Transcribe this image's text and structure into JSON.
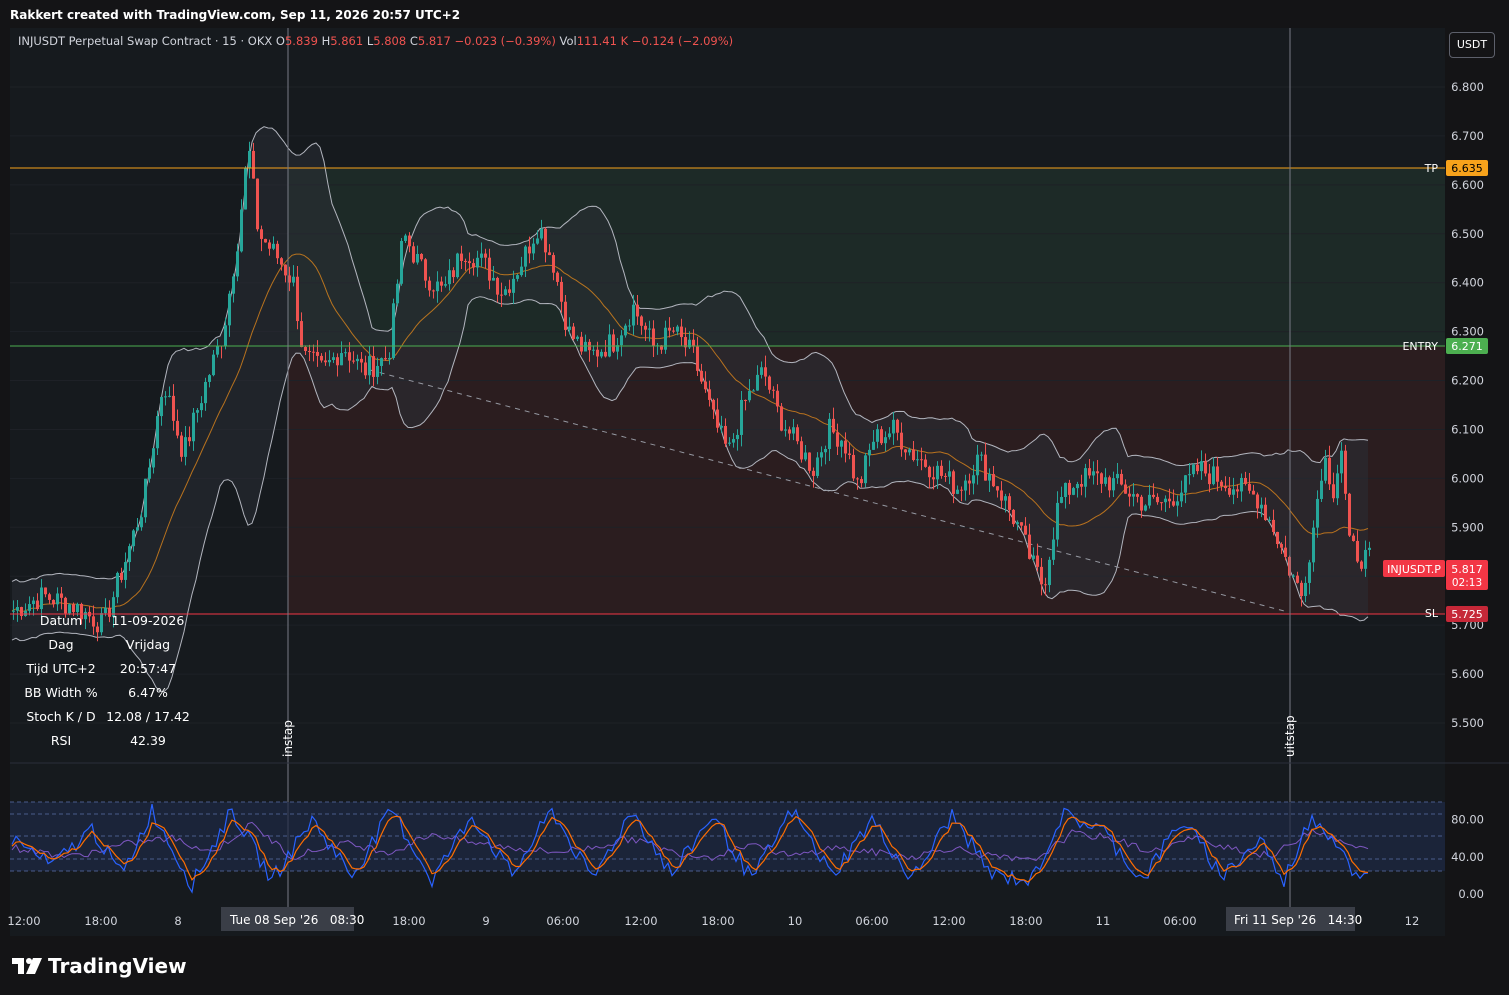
{
  "header": {
    "created_text": "Rakkert created with TradingView.com, Sep 11, 2026 20:57 UTC+2"
  },
  "legend": {
    "symbol": "INJUSDT Perpetual Swap Contract · 15 · OKX",
    "o_label": "O",
    "o_value": "5.839",
    "h_label": "H",
    "h_value": "5.861",
    "l_label": "L",
    "l_value": "5.808",
    "c_label": "C",
    "c_value": "5.817",
    "change": "−0.023 (−0.39%)",
    "vol_label": "Vol",
    "vol_value": "111.41 K",
    "vol_change": "−0.124 (−2.09%)"
  },
  "unit_label": "USDT",
  "price_axis": {
    "ticks": [
      "6.800",
      "6.700",
      "6.600",
      "6.500",
      "6.400",
      "6.300",
      "6.200",
      "6.100",
      "6.000",
      "5.900",
      "5.800",
      "5.700",
      "5.600",
      "5.500"
    ]
  },
  "osc_axis": {
    "ticks": [
      "80.00",
      "40.00",
      "0.00"
    ]
  },
  "time_axis": {
    "labels": [
      "12:00",
      "18:00",
      "8",
      "18:00",
      "9",
      "06:00",
      "12:00",
      "18:00",
      "10",
      "06:00",
      "12:00",
      "18:00",
      "11",
      "06:00",
      "12"
    ],
    "highlight_left": "Tue 08 Sep '26   08:30",
    "highlight_right": "Fri 11 Sep '26   14:30"
  },
  "levels": {
    "tp": {
      "label": "TP",
      "value": "6.635",
      "color": "#f7a21b"
    },
    "entry": {
      "label": "ENTRY",
      "value": "6.271",
      "color": "#4caf50"
    },
    "sl": {
      "label": "SL",
      "value": "5.725",
      "color": "#f23645"
    },
    "current": {
      "label": "INJUSDT.P",
      "value": "5.817",
      "countdown": "02:13",
      "color": "#f23645"
    }
  },
  "markers": {
    "entry_label": "instap",
    "exit_label": "uitstap"
  },
  "info_table": [
    {
      "label": "Datum",
      "value": "11-09-2026"
    },
    {
      "label": "Dag",
      "value": "Vrijdag"
    },
    {
      "label": "Tijd UTC+2",
      "value": "20:57:47"
    },
    {
      "label": "BB Width %",
      "value": "6.47%"
    },
    {
      "label": "Stoch K / D",
      "value": "12.08 / 17.42"
    },
    {
      "label": "RSI",
      "value": "42.39"
    }
  ],
  "brand": "TradingView",
  "colors": {
    "up": "#26a69a",
    "down": "#ef5350",
    "bb_mid": "#f7931a",
    "stoch_k": "#2962ff",
    "stoch_d": "#ff6d00"
  },
  "chart_data": {
    "type": "candlestick",
    "title": "INJUSDT Perpetual Swap Contract · 15 · OKX",
    "ylim": [
      5.4,
      6.9
    ],
    "close_path": [
      [
        0,
        5.73
      ],
      [
        30,
        5.76
      ],
      [
        60,
        5.74
      ],
      [
        90,
        5.7
      ],
      [
        110,
        5.82
      ],
      [
        130,
        5.95
      ],
      [
        150,
        6.2
      ],
      [
        170,
        6.05
      ],
      [
        190,
        6.18
      ],
      [
        210,
        6.3
      ],
      [
        225,
        6.5
      ],
      [
        235,
        6.68
      ],
      [
        245,
        6.5
      ],
      [
        265,
        6.45
      ],
      [
        280,
        6.4
      ],
      [
        290,
        6.25
      ],
      [
        310,
        6.22
      ],
      [
        330,
        6.27
      ],
      [
        350,
        6.22
      ],
      [
        375,
        6.25
      ],
      [
        390,
        6.5
      ],
      [
        410,
        6.42
      ],
      [
        430,
        6.38
      ],
      [
        450,
        6.47
      ],
      [
        470,
        6.44
      ],
      [
        490,
        6.38
      ],
      [
        510,
        6.45
      ],
      [
        525,
        6.52
      ],
      [
        540,
        6.44
      ],
      [
        555,
        6.3
      ],
      [
        575,
        6.25
      ],
      [
        600,
        6.28
      ],
      [
        620,
        6.35
      ],
      [
        640,
        6.27
      ],
      [
        660,
        6.3
      ],
      [
        680,
        6.25
      ],
      [
        700,
        6.12
      ],
      [
        715,
        6.05
      ],
      [
        730,
        6.15
      ],
      [
        750,
        6.22
      ],
      [
        765,
        6.13
      ],
      [
        780,
        6.08
      ],
      [
        800,
        6.02
      ],
      [
        815,
        6.1
      ],
      [
        830,
        6.08
      ],
      [
        845,
        5.98
      ],
      [
        860,
        6.08
      ],
      [
        880,
        6.1
      ],
      [
        900,
        6.05
      ],
      [
        920,
        6.02
      ],
      [
        945,
        5.98
      ],
      [
        965,
        6.04
      ],
      [
        985,
        5.98
      ],
      [
        1005,
        5.9
      ],
      [
        1020,
        5.82
      ],
      [
        1030,
        5.78
      ],
      [
        1045,
        5.95
      ],
      [
        1065,
        6.0
      ],
      [
        1090,
        6.0
      ],
      [
        1110,
        5.98
      ],
      [
        1130,
        5.95
      ],
      [
        1150,
        5.95
      ],
      [
        1170,
        5.98
      ],
      [
        1185,
        6.02
      ],
      [
        1205,
        6.0
      ],
      [
        1225,
        5.98
      ],
      [
        1245,
        5.96
      ],
      [
        1260,
        5.9
      ],
      [
        1275,
        5.82
      ],
      [
        1288,
        5.76
      ],
      [
        1300,
        5.9
      ],
      [
        1310,
        6.05
      ],
      [
        1320,
        5.98
      ],
      [
        1328,
        6.06
      ],
      [
        1336,
        5.86
      ],
      [
        1348,
        5.84
      ],
      [
        1360,
        5.83
      ],
      [
        1370,
        5.82
      ]
    ],
    "stoch_path": [
      [
        0,
        60
      ],
      [
        40,
        30
      ],
      [
        80,
        70
      ],
      [
        110,
        20
      ],
      [
        140,
        90
      ],
      [
        180,
        10
      ],
      [
        220,
        90
      ],
      [
        260,
        15
      ],
      [
        300,
        80
      ],
      [
        340,
        20
      ],
      [
        380,
        90
      ],
      [
        420,
        15
      ],
      [
        460,
        85
      ],
      [
        500,
        20
      ],
      [
        540,
        90
      ],
      [
        580,
        15
      ],
      [
        620,
        90
      ],
      [
        660,
        20
      ],
      [
        700,
        85
      ],
      [
        740,
        15
      ],
      [
        780,
        90
      ],
      [
        820,
        20
      ],
      [
        860,
        80
      ],
      [
        900,
        15
      ],
      [
        940,
        85
      ],
      [
        980,
        20
      ],
      [
        1020,
        15
      ],
      [
        1050,
        85
      ],
      [
        1090,
        70
      ],
      [
        1130,
        15
      ],
      [
        1170,
        80
      ],
      [
        1210,
        20
      ],
      [
        1250,
        60
      ],
      [
        1270,
        10
      ],
      [
        1300,
        85
      ],
      [
        1330,
        50
      ],
      [
        1345,
        15
      ],
      [
        1370,
        20
      ]
    ],
    "rsi_path": [
      [
        0,
        50
      ],
      [
        60,
        40
      ],
      [
        120,
        55
      ],
      [
        160,
        60
      ],
      [
        200,
        45
      ],
      [
        240,
        75
      ],
      [
        280,
        40
      ],
      [
        330,
        55
      ],
      [
        380,
        45
      ],
      [
        420,
        65
      ],
      [
        460,
        55
      ],
      [
        500,
        50
      ],
      [
        540,
        45
      ],
      [
        580,
        50
      ],
      [
        620,
        60
      ],
      [
        660,
        45
      ],
      [
        700,
        40
      ],
      [
        740,
        55
      ],
      [
        780,
        40
      ],
      [
        820,
        50
      ],
      [
        860,
        45
      ],
      [
        900,
        40
      ],
      [
        940,
        50
      ],
      [
        980,
        40
      ],
      [
        1020,
        35
      ],
      [
        1060,
        65
      ],
      [
        1100,
        60
      ],
      [
        1140,
        45
      ],
      [
        1180,
        60
      ],
      [
        1220,
        50
      ],
      [
        1260,
        40
      ],
      [
        1300,
        70
      ],
      [
        1330,
        55
      ],
      [
        1370,
        42
      ]
    ]
  }
}
